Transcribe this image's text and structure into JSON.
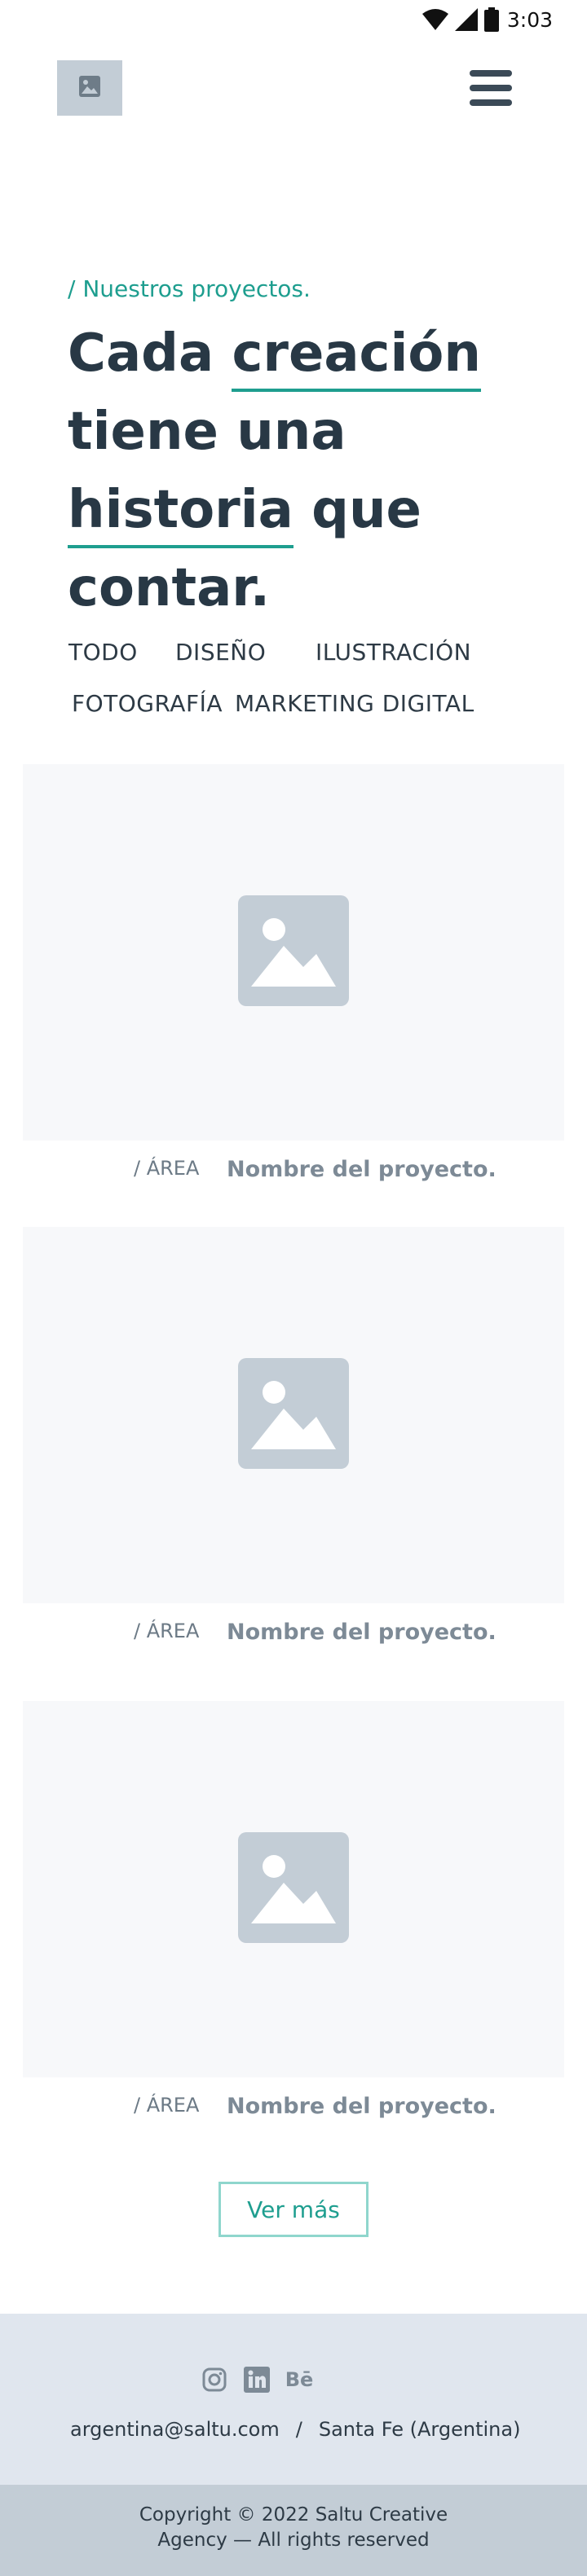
{
  "status_bar": {
    "time": "3:03",
    "icons": [
      "wifi-icon",
      "signal-icon",
      "battery-icon"
    ]
  },
  "header": {
    "logo_icon": "image-placeholder-icon",
    "menu_icon": "hamburger-menu-icon"
  },
  "hero": {
    "eyebrow": "/ Nuestros proyectos.",
    "title_parts": [
      "Cada ",
      "creación",
      " tiene una ",
      "historia",
      " que contar."
    ]
  },
  "filters": [
    "TODO",
    "DISEÑO",
    "ILUSTRACIÓN",
    "FOTOGRAFÍA",
    "MARKETING DIGITAL"
  ],
  "projects": [
    {
      "area": "/ ÁREA",
      "name": "Nombre del proyecto.",
      "image_icon": "image-placeholder-icon"
    },
    {
      "area": "/ ÁREA",
      "name": "Nombre del proyecto.",
      "image_icon": "image-placeholder-icon"
    },
    {
      "area": "/ ÁREA",
      "name": "Nombre del proyecto.",
      "image_icon": "image-placeholder-icon"
    }
  ],
  "more_button": "Ver más",
  "footer": {
    "social": [
      "instagram-icon",
      "linkedin-icon",
      "behance-icon"
    ],
    "behance_text": "Bē",
    "email": "argentina@saltu.com",
    "separator": "/",
    "location": "Santa Fe (Argentina)",
    "copyright_line1": "Copyright © 2022 Saltu Creative",
    "copyright_line2": "Agency — All rights reserved"
  },
  "colors": {
    "accent": "#1e9e8f",
    "text_dark": "#283845",
    "placeholder_bg": "#f7f8fa",
    "placeholder_icon": "#c3cdd6",
    "footer_bg": "#e0e6ee",
    "copyright_bg": "#c3cdd6"
  }
}
